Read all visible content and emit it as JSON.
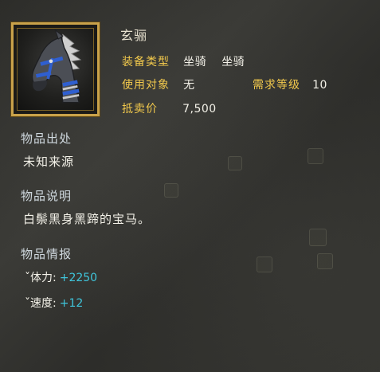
{
  "item": {
    "name": "玄骊",
    "portrait_icon": "horse-head-icon"
  },
  "attributes": {
    "equip_type_label": "装备类型",
    "equip_type_value_1": "坐骑",
    "equip_type_value_2": "坐骑",
    "use_target_label": "使用对象",
    "use_target_value": "无",
    "level_req_label": "需求等级",
    "level_req_value": "10",
    "sell_price_label": "抵卖价",
    "sell_price_value": "7,500"
  },
  "sections": {
    "origin_title": "物品出处",
    "origin_value": "未知来源",
    "desc_title": "物品说明",
    "desc_value": "白鬃黑身黑蹄的宝马。",
    "info_title": "物品情报"
  },
  "stats": [
    {
      "label": "ˇ体力:",
      "value": "+2250"
    },
    {
      "label": "ˇ速度:",
      "value": "+12"
    }
  ],
  "colors": {
    "label_gold": "#f2c94c",
    "stat_cyan": "#3fc6dc",
    "frame_gold": "#c9a24a"
  }
}
